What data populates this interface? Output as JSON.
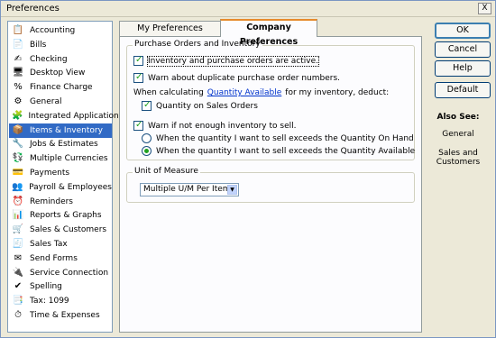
{
  "window": {
    "title": "Preferences",
    "close_label": "X"
  },
  "sidebar": {
    "items": [
      {
        "label": "Accounting",
        "icon": "📋",
        "active": false
      },
      {
        "label": "Bills",
        "icon": "📄",
        "active": false
      },
      {
        "label": "Checking",
        "icon": "✍",
        "active": false
      },
      {
        "label": "Desktop View",
        "icon": "🖥",
        "active": false
      },
      {
        "label": "Finance Charge",
        "icon": "%",
        "active": false
      },
      {
        "label": "General",
        "icon": "⚙",
        "active": false
      },
      {
        "label": "Integrated Applications",
        "icon": "🧩",
        "active": false
      },
      {
        "label": "Items & Inventory",
        "icon": "📦",
        "active": true
      },
      {
        "label": "Jobs & Estimates",
        "icon": "🔧",
        "active": false
      },
      {
        "label": "Multiple Currencies",
        "icon": "💱",
        "active": false
      },
      {
        "label": "Payments",
        "icon": "💳",
        "active": false
      },
      {
        "label": "Payroll & Employees",
        "icon": "👥",
        "active": false
      },
      {
        "label": "Reminders",
        "icon": "⏰",
        "active": false
      },
      {
        "label": "Reports & Graphs",
        "icon": "📊",
        "active": false
      },
      {
        "label": "Sales & Customers",
        "icon": "🛒",
        "active": false
      },
      {
        "label": "Sales Tax",
        "icon": "🧾",
        "active": false
      },
      {
        "label": "Send Forms",
        "icon": "✉",
        "active": false
      },
      {
        "label": "Service Connection",
        "icon": "🔌",
        "active": false
      },
      {
        "label": "Spelling",
        "icon": "✔",
        "active": false
      },
      {
        "label": "Tax: 1099",
        "icon": "📑",
        "active": false
      },
      {
        "label": "Time & Expenses",
        "icon": "⏱",
        "active": false
      }
    ]
  },
  "tabs": {
    "my_preferences": "My Preferences",
    "company_preferences": "Company Preferences"
  },
  "purchase_orders": {
    "title": "Purchase Orders and Inventory",
    "inventory_active": {
      "label": "Inventory and purchase orders are active.",
      "checked": true
    },
    "warn_duplicate": {
      "label": "Warn about duplicate purchase order numbers.",
      "checked": true
    },
    "calc_prefix": "When calculating",
    "calc_link": "Quantity Available",
    "calc_suffix": "for my inventory, deduct:",
    "qty_sales_orders": {
      "label": "Quantity on Sales Orders",
      "checked": true
    },
    "warn_not_enough": {
      "label": "Warn if not enough inventory to sell.",
      "checked": true
    },
    "radio_on_hand": {
      "label": "When the quantity I want to sell exceeds the Quantity On Hand",
      "checked": false
    },
    "radio_available": {
      "label": "When the quantity I want to sell exceeds the Quantity Available",
      "checked": true
    }
  },
  "unit_of_measure": {
    "title": "Unit of Measure",
    "selected": "Multiple U/M Per Item"
  },
  "buttons": {
    "ok": "OK",
    "cancel": "Cancel",
    "help": "Help",
    "default": "Default"
  },
  "also_see": {
    "title": "Also See:",
    "links": [
      "General",
      "Sales and Customers"
    ]
  },
  "colors": {
    "selection": "#316ac5",
    "check_green": "#21a121",
    "link_blue": "#0033cc",
    "tab_highlight": "#e68b2c"
  }
}
